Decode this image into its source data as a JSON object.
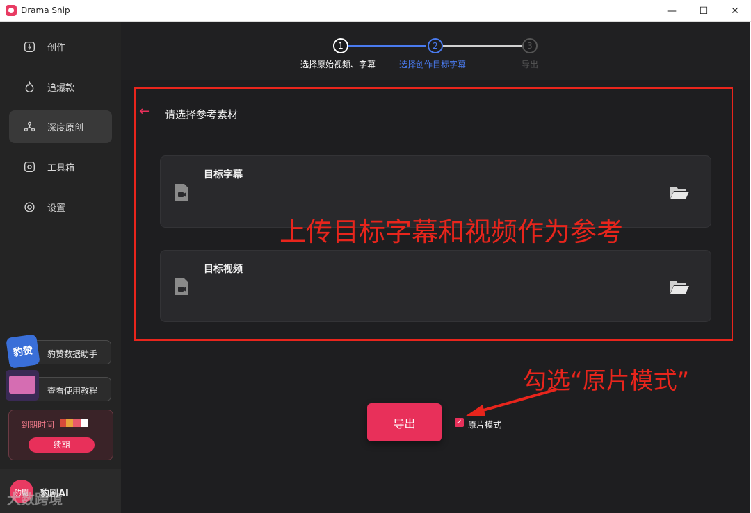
{
  "window": {
    "title": "Drama Snip_",
    "minimize": "—",
    "maximize": "☐",
    "close": "✕"
  },
  "sidebar": {
    "items": [
      {
        "label": "创作",
        "icon": "bolt-icon"
      },
      {
        "label": "追爆款",
        "icon": "flame-icon"
      },
      {
        "label": "深度原创",
        "icon": "nodes-icon",
        "active": true
      },
      {
        "label": "工具箱",
        "icon": "toolbox-icon"
      },
      {
        "label": "设置",
        "icon": "settings-icon"
      }
    ],
    "data_assistant": "豹赞数据助手",
    "data_assistant_thumb": "豹赞",
    "tutorial": "查看使用教程",
    "expire_label": "到期时间",
    "renew": "续期",
    "brand_logo_text": "豹剧",
    "brand_name": "豹剧AI",
    "watermark": "大数跨境"
  },
  "steps": [
    {
      "number": "1",
      "label": "选择原始视频、字幕",
      "state": "done"
    },
    {
      "number": "2",
      "label": "选择创作目标字幕",
      "state": "active"
    },
    {
      "number": "3",
      "label": "导出",
      "state": "pending"
    }
  ],
  "panel": {
    "title": "请选择参考素材",
    "cards": [
      {
        "title": "目标字幕"
      },
      {
        "title": "目标视频"
      }
    ]
  },
  "annotations": {
    "main": "上传目标字幕和视频作为参考",
    "checkbox_hint": "勾选“原片模式”"
  },
  "actions": {
    "export": "导出",
    "original_mode": "原片模式",
    "original_mode_checked": true
  },
  "colors": {
    "accent": "#e8305a",
    "step_active": "#4a7bf0",
    "annotation": "#e8251c"
  }
}
